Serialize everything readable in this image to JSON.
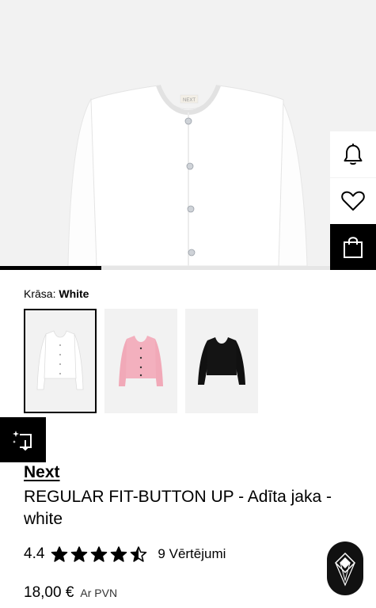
{
  "product": {
    "brand": "Next",
    "title": "REGULAR FIT-BUTTON UP - Adīta jaka - white",
    "color_label": "Krāsa:",
    "color_value": "White",
    "rating_value": "4.4",
    "rating_stars": 4.5,
    "reviews_text": "9 Vērtējumi",
    "price": "18,00 €",
    "vat_note": "Ar PVN",
    "hero_label_text": "NEXT"
  },
  "gallery": {
    "progress": 0.27
  },
  "swatches": [
    {
      "name": "white",
      "color": "#ffffff",
      "selected": true
    },
    {
      "name": "pink",
      "color": "#f1a9b8",
      "selected": false
    },
    {
      "name": "black",
      "color": "#111111",
      "selected": false
    }
  ],
  "icons": {
    "notify": "bell-icon",
    "wishlist": "heart-icon",
    "bag": "shopping-bag-icon",
    "try_on": "virtual-try-on-icon",
    "assistant": "assistant-logo-icon"
  },
  "colors": {
    "accent": "#000000",
    "background": "#ffffff",
    "image_bg": "#f2f2f2"
  }
}
